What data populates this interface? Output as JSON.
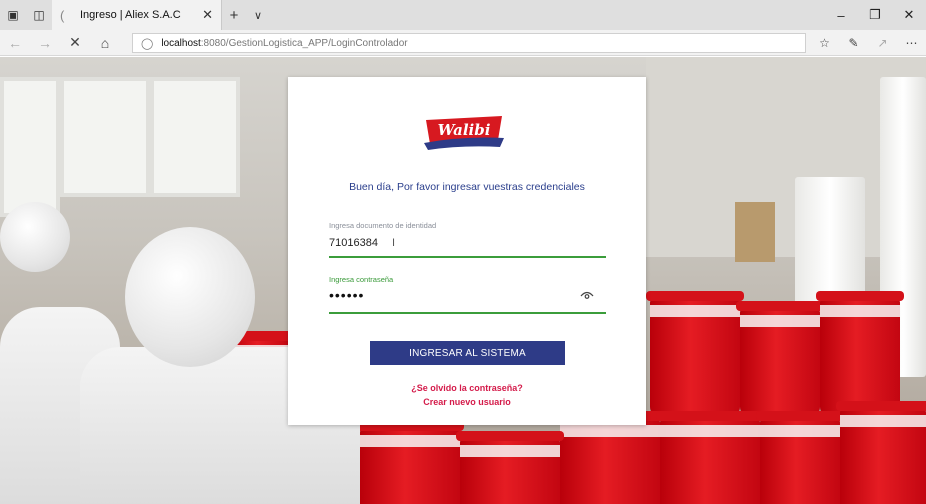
{
  "browser": {
    "tab_title": "Ingreso | Aliex S.A.C",
    "url_host": "localhost",
    "url_rest": ":8080/GestionLogistica_APP/LoginControlador"
  },
  "login": {
    "logo_text": "Walibi",
    "greeting": "Buen día, Por favor ingresar vuestras credenciales",
    "id_label": "Ingresa documento de identidad",
    "id_value": "71016384",
    "password_label": "Ingresa contraseña",
    "password_value": "••••••",
    "submit_label": "INGRESAR AL SISTEMA",
    "forgot_link": "¿Se olvido la contraseña?",
    "register_link": "Crear nuevo usuario"
  },
  "colors": {
    "primary_button": "#2e3b87",
    "link": "#d41b4a",
    "field_active": "#3b9d3b"
  },
  "icons": [
    "tab-actions-icon",
    "page-favicon",
    "close-icon",
    "plus-icon",
    "chevron-down-icon",
    "minimize-icon",
    "maximize-icon",
    "back-icon",
    "forward-icon",
    "stop-icon",
    "home-icon",
    "globe-icon",
    "favorites-icon",
    "pen-icon",
    "share-icon",
    "more-icon",
    "eye-icon"
  ]
}
